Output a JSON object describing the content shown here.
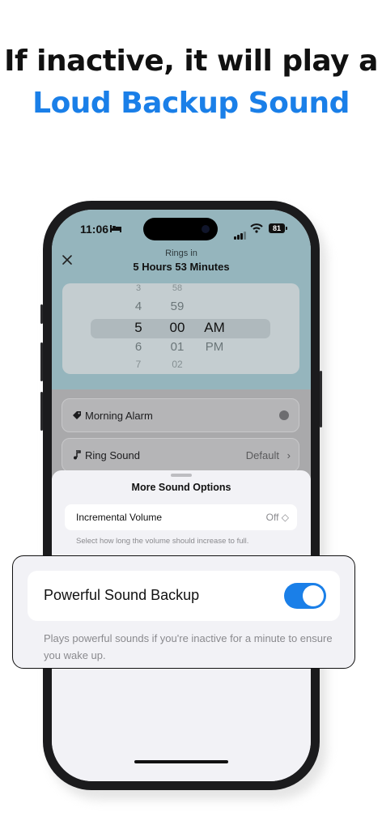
{
  "headline": {
    "line1": "If inactive, it will play a",
    "line2": "Loud Backup Sound"
  },
  "colors": {
    "accent": "#1a7fe8",
    "header_bg": "#95b5bd"
  },
  "status_bar": {
    "time": "11:06",
    "sleep_icon": "bed-icon",
    "battery": "81"
  },
  "header": {
    "close_icon": "close-icon",
    "rings_in_label": "Rings in",
    "rings_in_value": "5 Hours 53 Minutes"
  },
  "time_picker": {
    "hours": [
      "3",
      "4",
      "5",
      "6",
      "7"
    ],
    "minutes": [
      "58",
      "59",
      "00",
      "01",
      "02"
    ],
    "period": [
      "",
      "",
      "AM",
      "PM",
      ""
    ],
    "selected": {
      "hour": "5",
      "minute": "00",
      "period": "AM"
    }
  },
  "alarm_label": {
    "icon": "tag-icon",
    "value": "Morning Alarm"
  },
  "ring_sound": {
    "icon": "music-note-icon",
    "label": "Ring Sound",
    "value": "Default",
    "chevron": "›"
  },
  "sound_sheet": {
    "title": "More Sound Options",
    "incremental_volume": {
      "label": "Incremental Volume",
      "value": "Off ◇"
    },
    "incremental_help": "Select how long the volume should increase to full."
  },
  "callout": {
    "label": "Powerful Sound Backup",
    "enabled": true,
    "description": "Plays powerful sounds if you're inactive for a minute to ensure you wake up."
  }
}
